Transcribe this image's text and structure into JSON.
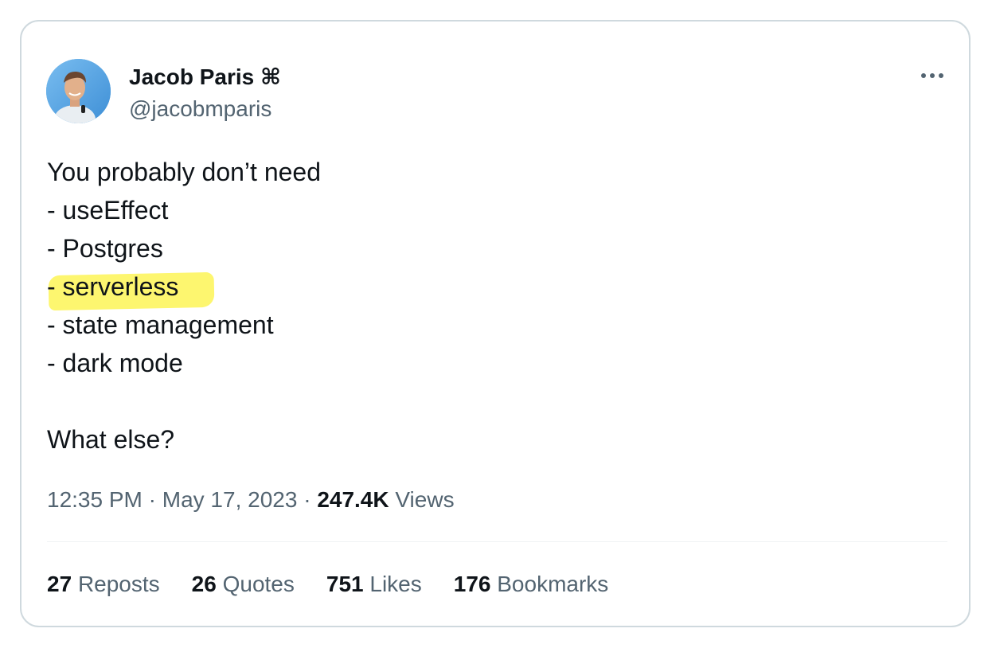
{
  "author": {
    "name": "Jacob Paris ⌘",
    "handle": "@jacobmparis"
  },
  "tweet": {
    "lines": [
      "You probably don’t need",
      "- useEffect",
      "- Postgres",
      "- serverless",
      "- state management",
      "- dark mode",
      "",
      "What else?"
    ],
    "highlighted_line": "- serverless"
  },
  "meta": {
    "time": "12:35 PM",
    "separator": " · ",
    "date": "May 17, 2023",
    "views_count": "247.4K",
    "views_label": "Views"
  },
  "stats": [
    {
      "count": "27",
      "label": "Reposts"
    },
    {
      "count": "26",
      "label": "Quotes"
    },
    {
      "count": "751",
      "label": "Likes"
    },
    {
      "count": "176",
      "label": "Bookmarks"
    }
  ],
  "colors": {
    "text": "#0f1419",
    "secondary": "#536471",
    "border": "#cfd9de",
    "highlight": "#fdf66f"
  },
  "icons": {
    "more": "more-horizontal-icon"
  }
}
